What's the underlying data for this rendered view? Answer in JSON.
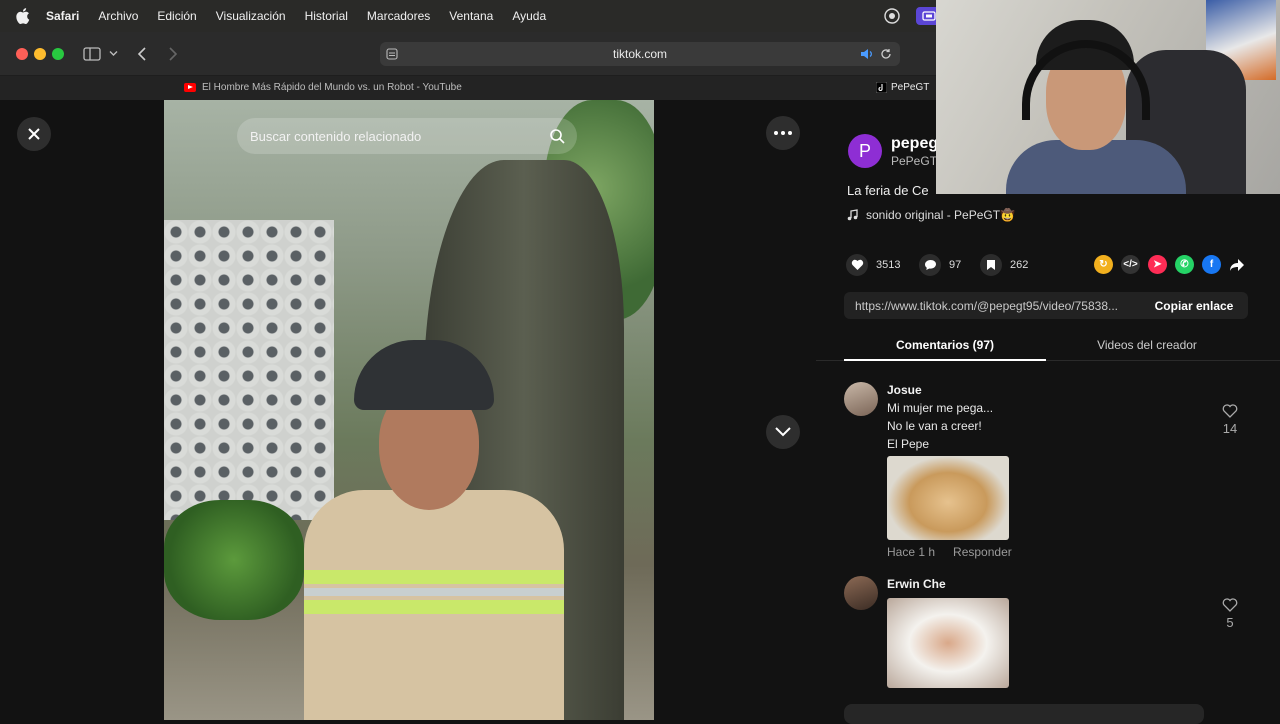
{
  "menubar": {
    "items": [
      "Safari",
      "Archivo",
      "Edición",
      "Visualización",
      "Historial",
      "Marcadores",
      "Ventana",
      "Ayuda"
    ]
  },
  "browser": {
    "url": "tiktok.com",
    "tabs": [
      {
        "title": "El Hombre Más Rápido del Mundo vs. un Robot - YouTube"
      },
      {
        "title": "PePeGT"
      }
    ]
  },
  "video": {
    "search_placeholder": "Buscar contenido relacionado"
  },
  "post": {
    "avatar_letter": "P",
    "author_name": "pepeg",
    "author_handle": "PePeGT",
    "description": "La feria de Ce",
    "sound": "sonido original - PePeGT🤠",
    "likes": "3513",
    "comments": "97",
    "saves": "262",
    "share_link": "https://www.tiktok.com/@pepegt95/video/75838...",
    "copy_label": "Copiar enlace"
  },
  "tabs": {
    "comments": "Comentarios (97)",
    "videos": "Videos del creador"
  },
  "comments": [
    {
      "user": "Josue",
      "lines": [
        "Mi mujer me pega...",
        "No le van a creer!",
        "El Pepe"
      ],
      "time": "Hace 1 h",
      "reply": "Responder",
      "likes": "14"
    },
    {
      "user": "Erwin Che",
      "likes": "5"
    }
  ],
  "colors": {
    "accent_avatar": "#8e2ed4",
    "badge": "#5b46d6"
  }
}
